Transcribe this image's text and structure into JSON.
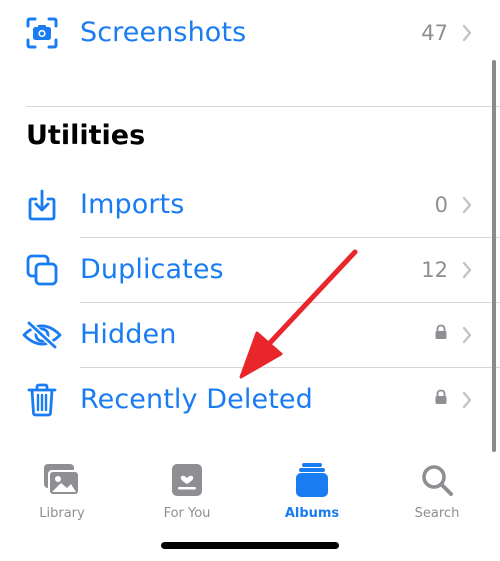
{
  "albums": {
    "screenshots": {
      "label": "Screenshots",
      "count": "47"
    }
  },
  "utilities": {
    "title": "Utilities",
    "items": [
      {
        "label": "Imports",
        "count": "0",
        "icon": "import-icon"
      },
      {
        "label": "Duplicates",
        "count": "12",
        "icon": "duplicates-icon"
      },
      {
        "label": "Hidden",
        "count": "",
        "icon": "eye-slash-icon",
        "locked": true
      },
      {
        "label": "Recently Deleted",
        "count": "",
        "icon": "trash-icon",
        "locked": true
      }
    ]
  },
  "tabbar": {
    "tabs": [
      {
        "label": "Library",
        "active": false
      },
      {
        "label": "For You",
        "active": false
      },
      {
        "label": "Albums",
        "active": true
      },
      {
        "label": "Search",
        "active": false
      }
    ]
  },
  "colors": {
    "accent": "#1a7cf2",
    "secondary": "#8e8e93",
    "annotation_arrow": "#e8262b"
  }
}
